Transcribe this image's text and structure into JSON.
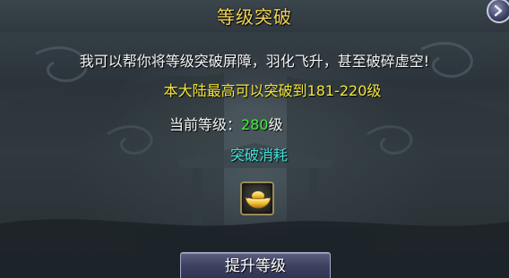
{
  "dialog": {
    "title": "等级突破",
    "description": "我可以帮你将等级突破屏障，羽化飞升，甚至破碎虚空!",
    "limit_text": "本大陆最高可以突破到181-220级",
    "current_level_label": "当前等级：",
    "current_level_value": "280",
    "current_level_suffix": "级",
    "cost_title": "突破消耗",
    "cost_item_icon": "gold-ingot-icon",
    "upgrade_button": "提升等级",
    "close_icon": "close-icon"
  },
  "colors": {
    "title": "#f2d55a",
    "limit": "#f4e43a",
    "level_value": "#3ff03a",
    "cost_title": "#3fe0d8"
  }
}
